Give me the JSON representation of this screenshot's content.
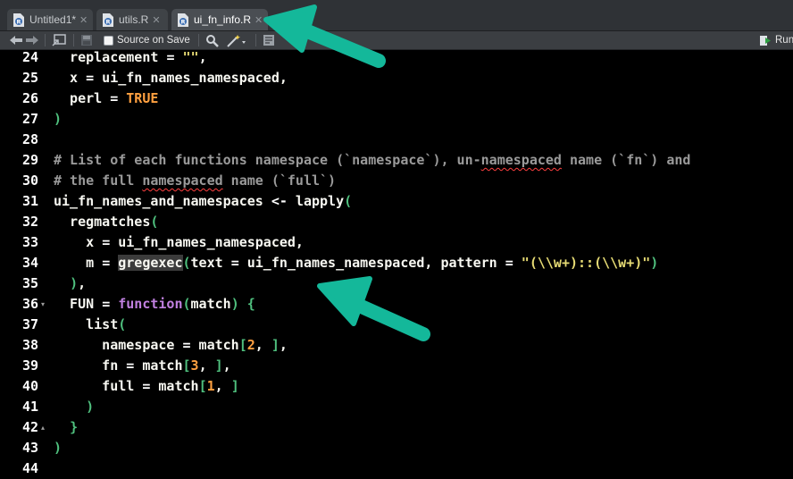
{
  "tabs": [
    {
      "label": "Untitled1*",
      "active": false
    },
    {
      "label": "utils.R",
      "active": false
    },
    {
      "label": "ui_fn_info.R",
      "active": true
    }
  ],
  "toolbar": {
    "source_on_save_label": "Source on Save",
    "run_label": "Run"
  },
  "editor": {
    "lines": [
      {
        "num": "24",
        "fold": ""
      },
      {
        "num": "25",
        "fold": ""
      },
      {
        "num": "26",
        "fold": ""
      },
      {
        "num": "27",
        "fold": ""
      },
      {
        "num": "28",
        "fold": ""
      },
      {
        "num": "29",
        "fold": ""
      },
      {
        "num": "30",
        "fold": ""
      },
      {
        "num": "31",
        "fold": ""
      },
      {
        "num": "32",
        "fold": ""
      },
      {
        "num": "33",
        "fold": ""
      },
      {
        "num": "34",
        "fold": ""
      },
      {
        "num": "35",
        "fold": ""
      },
      {
        "num": "36",
        "fold": "▾"
      },
      {
        "num": "37",
        "fold": ""
      },
      {
        "num": "38",
        "fold": ""
      },
      {
        "num": "39",
        "fold": ""
      },
      {
        "num": "40",
        "fold": ""
      },
      {
        "num": "41",
        "fold": ""
      },
      {
        "num": "42",
        "fold": "▴"
      },
      {
        "num": "43",
        "fold": ""
      },
      {
        "num": "44",
        "fold": ""
      }
    ],
    "code": [
      [
        {
          "t": "  replacement ",
          "c": ""
        },
        {
          "t": "=",
          "c": "o"
        },
        {
          "t": " ",
          "c": ""
        },
        {
          "t": "\"\"",
          "c": "s"
        },
        {
          "t": ",",
          "c": ""
        }
      ],
      [
        {
          "t": "  x ",
          "c": ""
        },
        {
          "t": "=",
          "c": "o"
        },
        {
          "t": " ui_fn_names_namespaced,",
          "c": ""
        }
      ],
      [
        {
          "t": "  perl ",
          "c": ""
        },
        {
          "t": "=",
          "c": "o"
        },
        {
          "t": " ",
          "c": ""
        },
        {
          "t": "TRUE",
          "c": "n"
        }
      ],
      [
        {
          "t": ")",
          "c": "p"
        }
      ],
      [],
      [
        {
          "t": "# List of each functions namespace (`namespace`), un-",
          "c": "c"
        },
        {
          "t": "namespaced",
          "c": "c sq"
        },
        {
          "t": " name (`fn`) and",
          "c": "c"
        }
      ],
      [
        {
          "t": "# the full ",
          "c": "c"
        },
        {
          "t": "namespaced",
          "c": "c sq"
        },
        {
          "t": " name (`full`)",
          "c": "c"
        }
      ],
      [
        {
          "t": "ui_fn_names_and_namespaces ",
          "c": ""
        },
        {
          "t": "<-",
          "c": "o"
        },
        {
          "t": " lapply",
          "c": ""
        },
        {
          "t": "(",
          "c": "p"
        }
      ],
      [
        {
          "t": "  regmatches",
          "c": ""
        },
        {
          "t": "(",
          "c": "p"
        }
      ],
      [
        {
          "t": "    x ",
          "c": ""
        },
        {
          "t": "=",
          "c": "o"
        },
        {
          "t": " ui_fn_names_namespaced,",
          "c": ""
        }
      ],
      [
        {
          "t": "    m ",
          "c": ""
        },
        {
          "t": "=",
          "c": "o"
        },
        {
          "t": " ",
          "c": ""
        },
        {
          "t": "gregexec",
          "c": "hl"
        },
        {
          "t": "(",
          "c": "p"
        },
        {
          "t": "text ",
          "c": ""
        },
        {
          "t": "=",
          "c": "o"
        },
        {
          "t": " ui_fn_names_namespaced, pattern ",
          "c": ""
        },
        {
          "t": "=",
          "c": "o"
        },
        {
          "t": " ",
          "c": ""
        },
        {
          "t": "\"(\\\\w+)::(\\\\w+)\"",
          "c": "s"
        },
        {
          "t": ")",
          "c": "p"
        }
      ],
      [
        {
          "t": "  ",
          "c": ""
        },
        {
          "t": ")",
          "c": "p"
        },
        {
          "t": ",",
          "c": ""
        }
      ],
      [
        {
          "t": "  FUN ",
          "c": ""
        },
        {
          "t": "=",
          "c": "o"
        },
        {
          "t": " ",
          "c": ""
        },
        {
          "t": "function",
          "c": "k"
        },
        {
          "t": "(",
          "c": "p"
        },
        {
          "t": "match",
          "c": ""
        },
        {
          "t": ")",
          "c": "p"
        },
        {
          "t": " ",
          "c": ""
        },
        {
          "t": "{",
          "c": "p"
        }
      ],
      [
        {
          "t": "    list",
          "c": ""
        },
        {
          "t": "(",
          "c": "p"
        }
      ],
      [
        {
          "t": "      namespace ",
          "c": ""
        },
        {
          "t": "=",
          "c": "o"
        },
        {
          "t": " match",
          "c": ""
        },
        {
          "t": "[",
          "c": "p"
        },
        {
          "t": "2",
          "c": "n"
        },
        {
          "t": ", ",
          "c": ""
        },
        {
          "t": "]",
          "c": "p"
        },
        {
          "t": ",",
          "c": ""
        }
      ],
      [
        {
          "t": "      fn ",
          "c": ""
        },
        {
          "t": "=",
          "c": "o"
        },
        {
          "t": " match",
          "c": ""
        },
        {
          "t": "[",
          "c": "p"
        },
        {
          "t": "3",
          "c": "n"
        },
        {
          "t": ", ",
          "c": ""
        },
        {
          "t": "]",
          "c": "p"
        },
        {
          "t": ",",
          "c": ""
        }
      ],
      [
        {
          "t": "      full ",
          "c": ""
        },
        {
          "t": "=",
          "c": "o"
        },
        {
          "t": " match",
          "c": ""
        },
        {
          "t": "[",
          "c": "p"
        },
        {
          "t": "1",
          "c": "n"
        },
        {
          "t": ", ",
          "c": ""
        },
        {
          "t": "]",
          "c": "p"
        }
      ],
      [
        {
          "t": "    ",
          "c": ""
        },
        {
          "t": ")",
          "c": "p"
        }
      ],
      [
        {
          "t": "  ",
          "c": ""
        },
        {
          "t": "}",
          "c": "p"
        }
      ],
      [
        {
          "t": ")",
          "c": "p"
        }
      ],
      []
    ]
  },
  "colors": {
    "arrow": "#14b89a",
    "comment": "#9a9a9a",
    "string": "#e6db74",
    "number": "#ffa040",
    "keyword": "#c080e0",
    "paren": "#4fc07e"
  },
  "icons": [
    "r-file-icon",
    "close-icon",
    "back-arrow-icon",
    "forward-arrow-icon",
    "show-in-window-icon",
    "save-icon",
    "search-icon",
    "magic-wand-icon",
    "compile-report-icon",
    "run-icon",
    "annotation-arrow"
  ]
}
